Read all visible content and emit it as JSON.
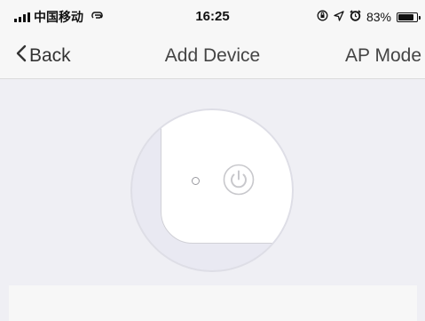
{
  "status_bar": {
    "carrier": "中国移动",
    "time": "16:25",
    "battery_percent": "83%",
    "battery_level": 0.83,
    "icons": [
      "signal-icon",
      "hotspot-icon",
      "orientation-lock-icon",
      "location-icon",
      "alarm-icon",
      "battery-icon"
    ]
  },
  "nav": {
    "back_label": "Back",
    "title": "Add Device",
    "right_label": "AP Mode"
  },
  "illustration": {
    "icons": [
      "indicator-light-icon",
      "power-button-icon"
    ]
  }
}
